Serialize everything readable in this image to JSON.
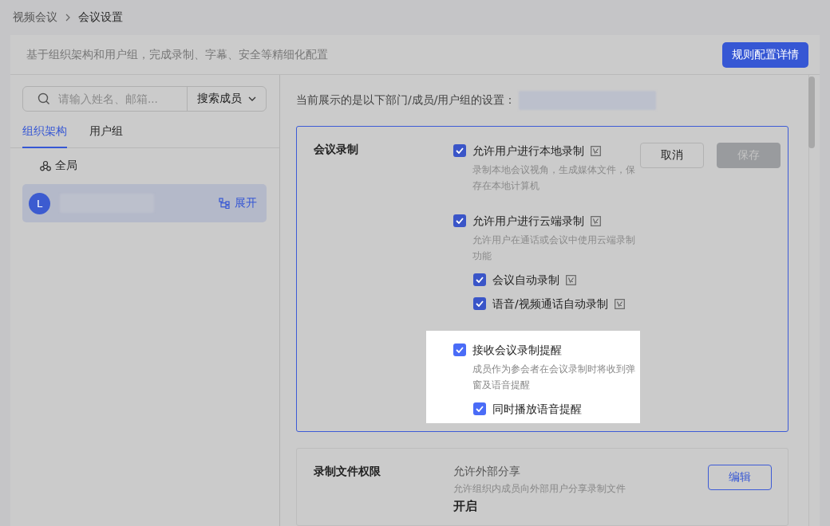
{
  "breadcrumb": [
    "视频会议",
    "会议设置"
  ],
  "header": {
    "description": "基于组织架构和用户组，完成录制、字幕、安全等精细化配置",
    "button": "规则配置详情"
  },
  "sidebar": {
    "search": {
      "placeholder": "请输入姓名、邮箱...",
      "scope": "搜索成员"
    },
    "tabs": [
      {
        "label": "组织架构",
        "selected": true
      },
      {
        "label": "用户组",
        "selected": false
      }
    ],
    "root": {
      "label": "全局"
    },
    "items": [
      {
        "avatar": "L",
        "action": "展开",
        "selected": true
      }
    ]
  },
  "content": {
    "scope_label": "当前展示的是以下部门/成员/用户组的设置：",
    "sections": [
      {
        "title": "会议录制",
        "active": true,
        "buttons": [
          {
            "label": "取消",
            "disabled": false
          },
          {
            "label": "保存",
            "disabled": true
          }
        ],
        "options": [
          {
            "label": "允许用户进行本地录制",
            "checked": true,
            "note_icon": true,
            "highlighted": false,
            "description": "录制本地会议视角，生成媒体文件，保存在本地计算机"
          },
          {
            "label": "允许用户进行云端录制",
            "checked": true,
            "note_icon": true,
            "highlighted": false,
            "description": "允许用户在通话或会议中使用云端录制功能",
            "children": [
              {
                "label": "会议自动录制",
                "checked": true,
                "note_icon": true
              },
              {
                "label": "语音/视频通话自动录制",
                "checked": true,
                "note_icon": true
              }
            ]
          },
          {
            "label": "接收会议录制提醒",
            "checked": true,
            "note_icon": false,
            "highlighted": true,
            "description": "成员作为参会者在会议录制时将收到弹窗及语音提醒",
            "children": [
              {
                "label": "同时播放语音提醒",
                "checked": true,
                "note_icon": false
              }
            ]
          }
        ]
      },
      {
        "title": "录制文件权限",
        "active": false,
        "edit_button": "编辑",
        "setting": {
          "label": "允许外部分享",
          "description": "允许组织内成员向外部用户分享录制文件",
          "value": "开启"
        }
      }
    ]
  }
}
